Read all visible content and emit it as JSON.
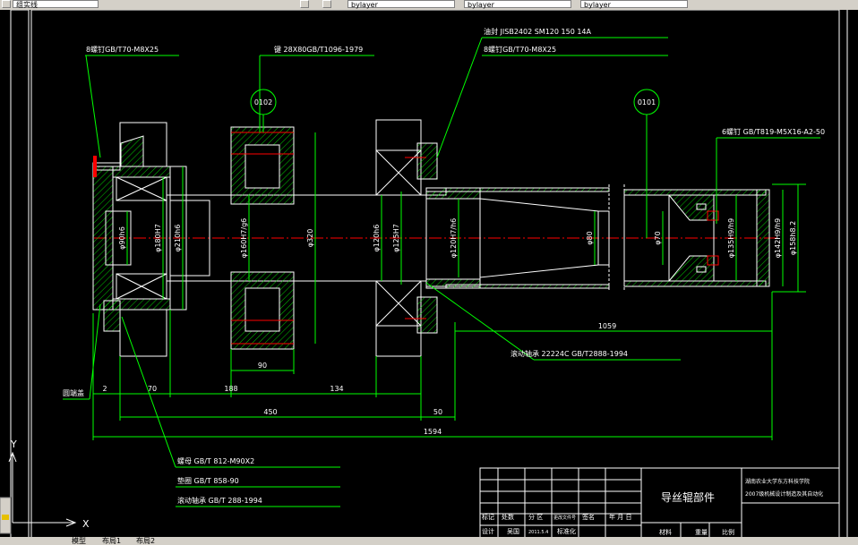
{
  "toolbar": {
    "layer_combo": "组实线",
    "combo_2": "bylayer",
    "combo_3": "bylayer",
    "combo_4": "bylayer"
  },
  "drawing": {
    "leaders": {
      "bolt_left": "8螺钉GB/T70-M8X25",
      "key": "键 28X80GB/T1096-1979",
      "seal": "油封 JISB2402 SM120 150 14A",
      "bolt_right": "8螺钉GB/T70-M8X25",
      "screw_right": "6螺钉 GB/T819-M5X16-A2-50",
      "bearing_mid": "滚动轴承 22224C GB/T2888-1994",
      "nut": "螺母 GB/T 812-M90X2",
      "washer": "垫圈 GB/T 858-90",
      "bearing_low": "滚动轴承 GB/T 288-1994",
      "end_cover": "圆端盖"
    },
    "balloons": {
      "b1": "0102",
      "b2": "0101"
    },
    "diameters": {
      "d1": "φ90h6",
      "d2": "φ180H7",
      "d3": "φ210h6",
      "d4": "φ160H7/g6",
      "d5": "φ320",
      "d6": "φ120h6",
      "d7": "φ125H7",
      "d8": "φ120H7/h6",
      "d9": "φ80",
      "d10": "φ70",
      "d11": "φ135H9/h9",
      "d12": "φ142H9/h9",
      "d13": "φ158h8.2"
    },
    "dims": {
      "d_90": "90",
      "d_2": "2",
      "d_70": "70",
      "d_188": "188",
      "d_134": "134",
      "d_450": "450",
      "d_50": "50",
      "d_1059": "1059",
      "d_1594": "1594"
    }
  },
  "title_block": {
    "title": "导丝辊部件",
    "school_1": "湖南农业大学东方科技学院",
    "school_2": "2007级机械设计制造及其自动化",
    "headers": [
      "标记",
      "处数",
      "分 区",
      "更改文件号",
      "签名",
      "年 月 日"
    ],
    "row2": [
      "设计",
      "吴国",
      "2011.5.4",
      "标准化"
    ],
    "material": "材料",
    "weight": "重量",
    "scale": "比例"
  },
  "ucs": {
    "x": "X",
    "y": "Y"
  },
  "layout_tabs": [
    "模型",
    "布局1",
    "布局2"
  ],
  "colors": {
    "outline": "#ffffff",
    "geometry": "#00ff00",
    "hatch": "#00ff00",
    "center": "#ff0000",
    "frame": "#ffffff"
  }
}
